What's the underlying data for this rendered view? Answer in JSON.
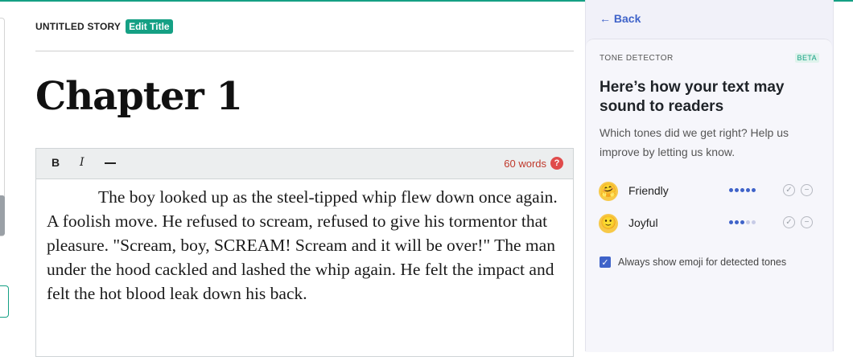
{
  "story": {
    "title": "UNTITLED STORY",
    "edit_label": "Edit Title"
  },
  "chapter_title": "Chapter 1",
  "toolbar": {
    "bold": "B",
    "italic": "I",
    "word_count": "60 words",
    "help": "?"
  },
  "editor": {
    "text": "The boy looked up as the steel-tipped whip flew down once again. A foolish move. He refused to scream, refused to give his tormentor that pleasure. \"Scream, boy, SCREAM! Scream and it will be over!\" The man under the hood cackled and lashed the whip again. He felt the impact and felt the hot blood leak down his back."
  },
  "panel": {
    "back_label": "← Back",
    "section_label": "TONE DETECTOR",
    "beta": "BETA",
    "heading": "Here’s how your text may sound to readers",
    "subtext": "Which tones did we get right? Help us improve by letting us know.",
    "tones": [
      {
        "emoji": "🤗",
        "name": "Friendly",
        "level": 5,
        "max": 5
      },
      {
        "emoji": "🙂",
        "name": "Joyful",
        "level": 3,
        "max": 5
      }
    ],
    "checkbox_label": "Always show emoji for detected tones",
    "checkbox_checked": true
  },
  "icons": {
    "confirm": "check-circle-icon",
    "reject": "minus-circle-icon"
  },
  "colors": {
    "accent": "#15a084",
    "link": "#3f63c9",
    "warning": "#e04b4b"
  }
}
